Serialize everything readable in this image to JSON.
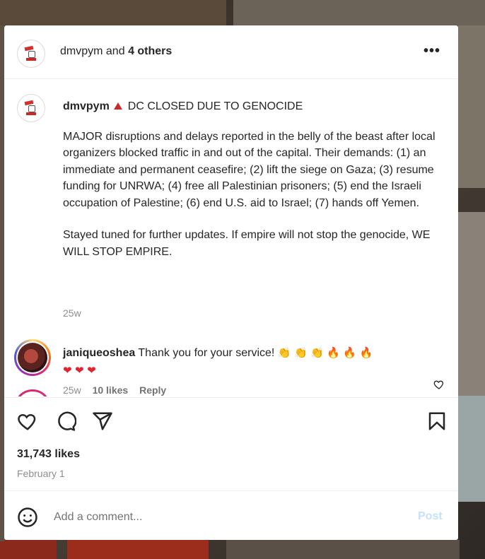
{
  "header": {
    "username": "dmvpym",
    "and_text": "and",
    "others_text": "4 others",
    "more_icon": "more-horizontal-icon"
  },
  "caption": {
    "username": "dmvpym",
    "title": "DC CLOSED DUE TO GENOCIDE",
    "body": "MAJOR disruptions and delays reported in the belly of the beast after local organizers blocked traffic in and out of the capital. Their demands: (1) an immediate and permanent ceasefire; (2) lift the siege on Gaza; (3) resume funding for UNRWA; (4) free all Palestinian prisoners; (5) end the Israeli occupation of Palestine; (6) end U.S. aid to Israel; (7) hands off Yemen.",
    "closing": "Stayed tuned for further updates. If empire will not stop the genocide, WE WILL STOP EMPIRE.",
    "timestamp": "25w"
  },
  "comment": {
    "username": "janiqueoshea",
    "text": "Thank you for your service!",
    "emojis": [
      "👏",
      "👏",
      "👏",
      "🔥",
      "🔥",
      "🔥",
      "❤",
      "❤",
      "❤"
    ],
    "time": "25w",
    "likes": "10 likes",
    "reply": "Reply"
  },
  "actions": {
    "likes": "31,743 likes",
    "date": "February 1"
  },
  "comment_box": {
    "placeholder": "Add a comment...",
    "post_label": "Post"
  },
  "colors": {
    "accent": "#0095f6",
    "post_disabled": "#c5e1fd",
    "muted": "#8e8e8e"
  }
}
